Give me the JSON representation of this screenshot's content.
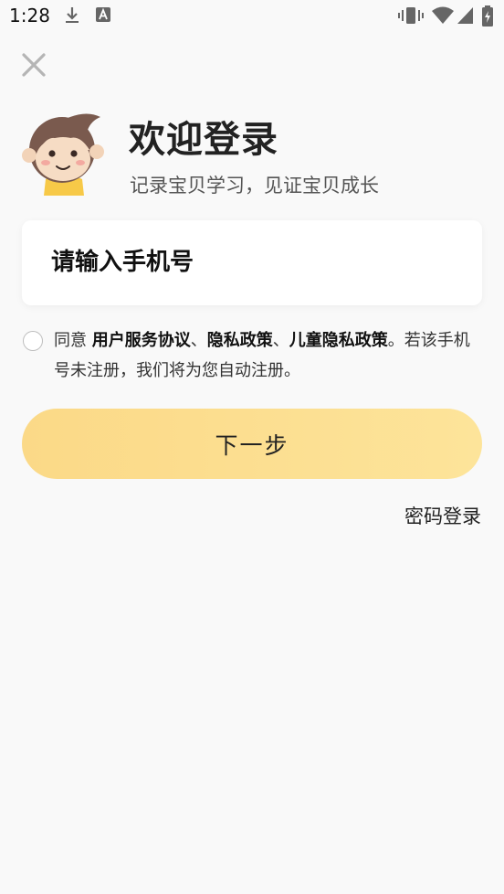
{
  "status_bar": {
    "time": "1:28",
    "icons": [
      "download-icon",
      "font-icon",
      "vibrate-icon",
      "wifi-icon",
      "signal-icon",
      "battery-icon"
    ]
  },
  "header": {
    "close_icon": "close-icon",
    "title": "欢迎登录",
    "subtitle": "记录宝贝学习，见证宝贝成长"
  },
  "form": {
    "phone_placeholder": "请输入手机号",
    "phone_value": ""
  },
  "agreement": {
    "checked": false,
    "prefix": "同意 ",
    "user_agreement": "用户服务协议",
    "sep1": "、",
    "privacy_policy": "隐私政策",
    "sep2": "、",
    "child_privacy": "儿童隐私政策",
    "suffix": "。若该手机号未注册，我们将为您自动注册。"
  },
  "actions": {
    "next_label": "下一步",
    "password_login": "密码登录"
  },
  "colors": {
    "background": "#f9f9f9",
    "button_yellow": "#fcdd90",
    "mascot_shirt": "#f7c948"
  }
}
